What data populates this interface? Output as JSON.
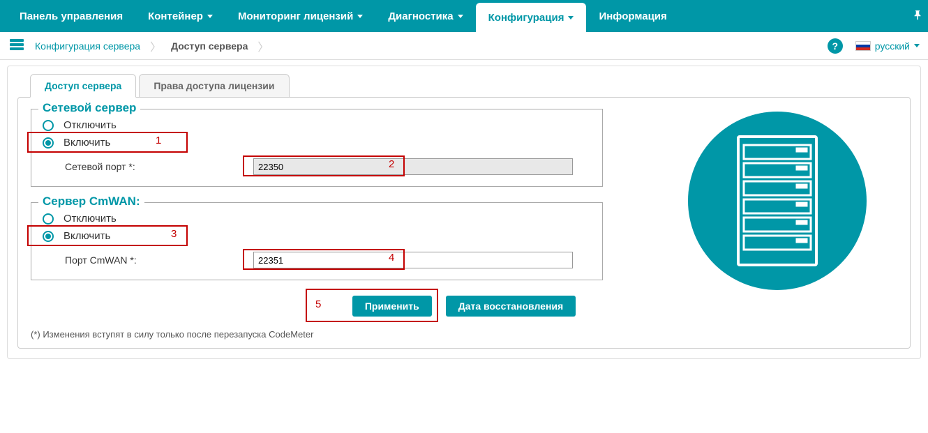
{
  "nav": {
    "dashboard": "Панель управления",
    "container": "Контейнер",
    "license_monitoring": "Мониторинг лицензий",
    "diagnostics": "Диагностика",
    "configuration": "Конфигурация",
    "information": "Информация"
  },
  "breadcrumb": {
    "root": "Конфигурация сервера",
    "current": "Доступ сервера"
  },
  "lang": {
    "label": "русский"
  },
  "tabs": {
    "server_access": "Доступ сервера",
    "license_rights": "Права доступа лицензии"
  },
  "network_server": {
    "legend": "Сетевой сервер",
    "disable": "Отключить",
    "enable": "Включить",
    "port_label": "Сетевой порт *:",
    "port_value": "22350"
  },
  "cmwan": {
    "legend": "Сервер CmWAN:",
    "disable": "Отключить",
    "enable": "Включить",
    "port_label": "Порт CmWAN *:",
    "port_value": "22351"
  },
  "buttons": {
    "apply": "Применить",
    "restore": "Дата восстановления"
  },
  "footnote": "(*) Изменения вступят в силу только после перезапуска CodeMeter",
  "annotations": {
    "n1": "1",
    "n2": "2",
    "n3": "3",
    "n4": "4",
    "n5": "5"
  }
}
